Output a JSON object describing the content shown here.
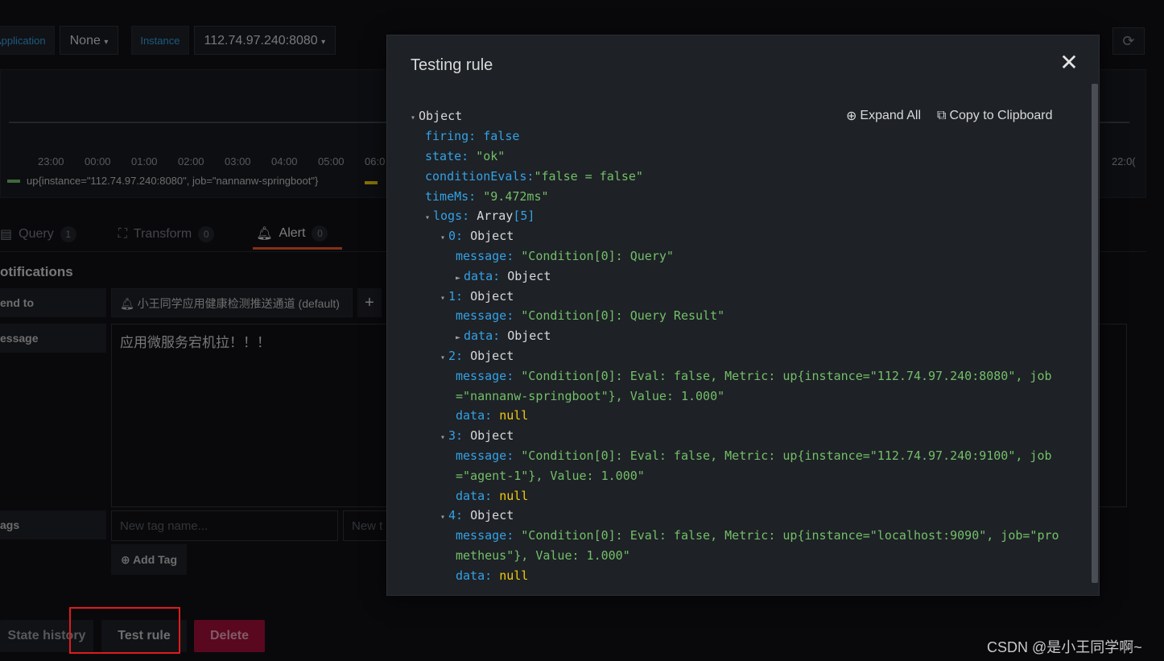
{
  "dashboard": {
    "variables": [
      {
        "label": "Application",
        "value": "None"
      },
      {
        "label": "Instance",
        "value": "112.74.97.240:8080"
      }
    ],
    "graph": {
      "x_ticks": [
        "23:00",
        "00:00",
        "01:00",
        "02:00",
        "03:00",
        "04:00",
        "05:00",
        "06:0"
      ],
      "x_tick_right": "22:0(",
      "legend_series": "up{instance=\"112.74.97.240:8080\", job=\"nannanw-springboot\"}"
    },
    "tabs": [
      {
        "label": "Query",
        "count": "1"
      },
      {
        "label": "Transform",
        "count": "0"
      },
      {
        "label": "Alert",
        "count": "0"
      }
    ],
    "notifications": {
      "title": "otifications",
      "send_to_label": "end to",
      "channel": "小王同学应用健康检测推送通道 (default)",
      "message_label": "essage",
      "message_value": "应用微服务宕机拉！！！",
      "tags_label": "ags",
      "tag_name_placeholder": "New tag name...",
      "tag_value_placeholder": "New t",
      "add_tag_label": "Add Tag"
    },
    "buttons": {
      "state_history": "State history",
      "test_rule": "Test rule",
      "delete": "Delete"
    }
  },
  "modal": {
    "title": "Testing rule",
    "close": "✕",
    "expand_all": "Expand All",
    "copy_clipboard": "Copy to Clipboard",
    "json_root": "Object",
    "firing_key": "firing:",
    "firing_val": "false",
    "state_key": "state:",
    "state_val": "\"ok\"",
    "cond_key": "conditionEvals:",
    "cond_val": "\"false = false\"",
    "time_key": "timeMs:",
    "time_val": "\"9.472ms\"",
    "logs_key": "logs:",
    "logs_type": "Array",
    "logs_count": "[5]",
    "logs": [
      {
        "idx": "0:",
        "type": "Object",
        "msg_key": "message:",
        "msg1": "\"Condition[0]: Query\"",
        "msg2": "",
        "data_key": "data:",
        "data_val": "Object"
      },
      {
        "idx": "1:",
        "type": "Object",
        "msg_key": "message:",
        "msg1": "\"Condition[0]: Query Result\"",
        "msg2": "",
        "data_key": "data:",
        "data_val": "Object"
      },
      {
        "idx": "2:",
        "type": "Object",
        "msg_key": "message:",
        "msg1": "\"Condition[0]: Eval: false, Metric: up{instance=\"112.74.97.240:8080\", job",
        "msg2": "=\"nannanw-springboot\"}, Value: 1.000\"",
        "data_key": "data:",
        "data_val": "null"
      },
      {
        "idx": "3:",
        "type": "Object",
        "msg_key": "message:",
        "msg1": "\"Condition[0]: Eval: false, Metric: up{instance=\"112.74.97.240:9100\", job",
        "msg2": "=\"agent-1\"}, Value: 1.000\"",
        "data_key": "data:",
        "data_val": "null"
      },
      {
        "idx": "4:",
        "type": "Object",
        "msg_key": "message:",
        "msg1": "\"Condition[0]: Eval: false, Metric: up{instance=\"localhost:9090\", job=\"pro",
        "msg2": "metheus\"}, Value: 1.000\"",
        "data_key": "data:",
        "data_val": "null"
      }
    ]
  },
  "watermark": "CSDN @是小王同学啊~",
  "colors": {
    "accent_tab": "#f05a28",
    "delete_button": "#a2103b",
    "highlight_box": "#e01b1b",
    "json_key": "#33a2e5",
    "json_string": "#73bf69",
    "json_null": "#f2cc0c"
  },
  "icons": [
    "close-icon",
    "plus-circle-icon",
    "copy-icon",
    "bell-icon",
    "database-icon",
    "transform-icon",
    "refresh-icon",
    "chevron-down-icon"
  ]
}
